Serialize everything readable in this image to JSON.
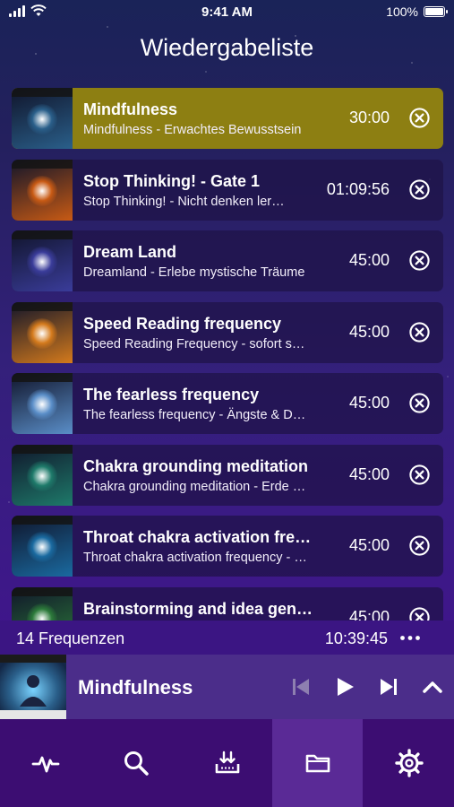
{
  "status_bar": {
    "time": "9:41 AM",
    "battery": "100%"
  },
  "header": {
    "title": "Wiedergabeliste"
  },
  "playlist": [
    {
      "title": "Mindfulness",
      "subtitle": "Mindfulness - Erwachtes Bewusstsein",
      "duration": "30:00",
      "active": true,
      "art_color": "#2a5f8a"
    },
    {
      "title": "Stop Thinking! - Gate 1",
      "subtitle": "Stop Thinking! - Nicht denken ler…",
      "duration": "01:09:56",
      "active": false,
      "art_color": "#c85a14"
    },
    {
      "title": "Dream Land",
      "subtitle": "Dreamland - Erlebe mystische Träume",
      "duration": "45:00",
      "active": false,
      "art_color": "#3a3c9a"
    },
    {
      "title": "Speed Reading frequency",
      "subtitle": "Speed Reading Frequency - sofort s…",
      "duration": "45:00",
      "active": false,
      "art_color": "#d47a1c"
    },
    {
      "title": "The fearless frequency",
      "subtitle": "The fearless frequency - Ängste & D…",
      "duration": "45:00",
      "active": false,
      "art_color": "#5a8ec8"
    },
    {
      "title": "Chakra grounding meditation",
      "subtitle": "Chakra grounding meditation - Erde …",
      "duration": "45:00",
      "active": false,
      "art_color": "#1e7a6a"
    },
    {
      "title": "Throat chakra activation fre…",
      "subtitle": "Throat chakra activation frequency - …",
      "duration": "45:00",
      "active": false,
      "art_color": "#1a6aa0"
    },
    {
      "title": "Brainstorming and idea gen…",
      "subtitle": "",
      "duration": "45:00",
      "active": false,
      "art_color": "#2c7a3a"
    }
  ],
  "summary": {
    "count": "14 Frequenzen",
    "total_duration": "10:39:45"
  },
  "player": {
    "title": "Mindfulness"
  },
  "tabs": [
    {
      "icon": "pulse-icon",
      "selected": false
    },
    {
      "icon": "search-icon",
      "selected": false
    },
    {
      "icon": "download-icon",
      "selected": false
    },
    {
      "icon": "folder-icon",
      "selected": true
    },
    {
      "icon": "gear-icon",
      "selected": false
    }
  ],
  "colors": {
    "active_row": "#8d7f12",
    "tabbar": "#3c0d72",
    "tab_selected": "#5a2a96",
    "player": "#4b2d8a"
  }
}
